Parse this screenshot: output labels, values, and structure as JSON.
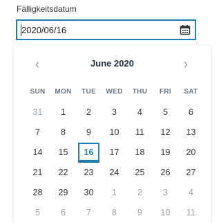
{
  "field": {
    "label": "Fälligkeitsdatum",
    "value": "2020/06/16",
    "icon": "calendar-icon"
  },
  "calendar": {
    "month_title": "June 2020",
    "prev_icon": "chevron-left-icon",
    "next_icon": "chevron-right-icon",
    "weekdays": [
      "SUN",
      "MON",
      "TUE",
      "WED",
      "THU",
      "FRI",
      "SAT"
    ],
    "selected_day": "16",
    "weeks": [
      [
        {
          "d": "31",
          "m": true
        },
        {
          "d": "1"
        },
        {
          "d": "2"
        },
        {
          "d": "3"
        },
        {
          "d": "4"
        },
        {
          "d": "5"
        },
        {
          "d": "6"
        }
      ],
      [
        {
          "d": "7"
        },
        {
          "d": "8"
        },
        {
          "d": "9"
        },
        {
          "d": "10"
        },
        {
          "d": "11"
        },
        {
          "d": "12"
        },
        {
          "d": "13"
        }
      ],
      [
        {
          "d": "14"
        },
        {
          "d": "15"
        },
        {
          "d": "16",
          "s": true
        },
        {
          "d": "17"
        },
        {
          "d": "18"
        },
        {
          "d": "19"
        },
        {
          "d": "20"
        }
      ],
      [
        {
          "d": "21"
        },
        {
          "d": "22"
        },
        {
          "d": "23"
        },
        {
          "d": "24"
        },
        {
          "d": "25"
        },
        {
          "d": "26"
        },
        {
          "d": "27"
        }
      ],
      [
        {
          "d": "28"
        },
        {
          "d": "29"
        },
        {
          "d": "30"
        },
        {
          "d": "1",
          "m": true
        },
        {
          "d": "2",
          "m": true
        },
        {
          "d": "3",
          "m": true
        },
        {
          "d": "4",
          "m": true
        }
      ],
      [
        {
          "d": "5",
          "m": true
        },
        {
          "d": "6",
          "m": true
        },
        {
          "d": "7",
          "m": true
        },
        {
          "d": "8",
          "m": true
        },
        {
          "d": "9",
          "m": true
        },
        {
          "d": "10",
          "m": true
        },
        {
          "d": "11",
          "m": true
        }
      ]
    ]
  },
  "colors": {
    "accent": "#1a7fba",
    "muted_text": "#9aa3ad",
    "text": "#333333"
  }
}
